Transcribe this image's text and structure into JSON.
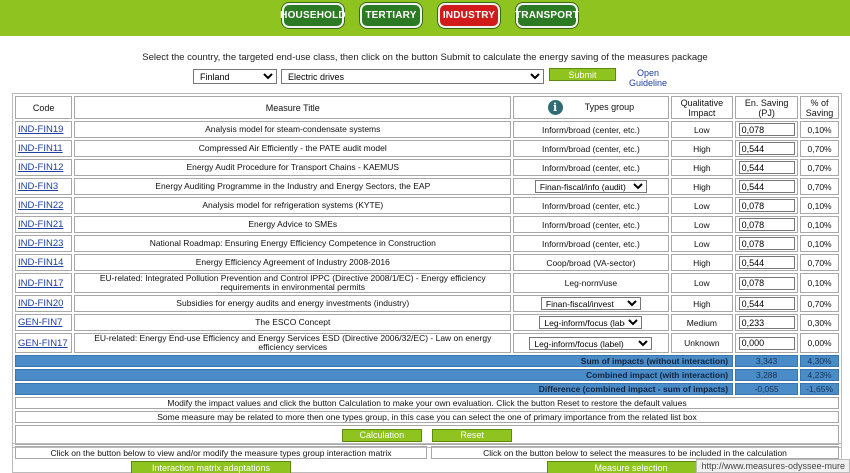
{
  "nav": {
    "household": "HOUSEHOLD",
    "tertiary": "TERTIARY",
    "industry": "INDUSTRY",
    "transport": "TRANSPORT"
  },
  "instructions": "Select the country, the targeted end-use class, then click on the button Submit to calculate the energy saving of the measures package",
  "filters": {
    "country": "Finland",
    "end_use": "Electric drives",
    "submit_label": "Submit",
    "guideline_label": "Open Guideline"
  },
  "table": {
    "headers": {
      "code": "Code",
      "title": "Measure Title",
      "types_group": "Types group",
      "impact": "Qualitative Impact",
      "saving": "En. Saving (PJ)",
      "pct": "% of Saving"
    },
    "rows": [
      {
        "code": "IND-FIN19",
        "title": "Analysis model for steam-condensate systems",
        "group": "Inform/broad (center, etc.)",
        "impact": "Low",
        "saving": "0,078",
        "pct": "0,10%"
      },
      {
        "code": "IND-FIN11",
        "title": "Compressed Air Efficiently - the PATE audit model",
        "group": "Inform/broad (center, etc.)",
        "impact": "High",
        "saving": "0,544",
        "pct": "0,70%"
      },
      {
        "code": "IND-FIN12",
        "title": "Energy Audit Procedure for Transport Chains - KAEMUS",
        "group": "Inform/broad (center, etc.)",
        "impact": "High",
        "saving": "0,544",
        "pct": "0,70%"
      },
      {
        "code": "IND-FIN3",
        "title": "Energy Auditing Programme in the Industry and Energy Sectors, the EAP",
        "group": "Finan-fiscal/info (audit)",
        "impact": "High",
        "saving": "0,544",
        "pct": "0,70%"
      },
      {
        "code": "IND-FIN22",
        "title": "Analysis model for refrigeration systems (KYTE)",
        "group": "Inform/broad (center, etc.)",
        "impact": "Low",
        "saving": "0,078",
        "pct": "0,10%"
      },
      {
        "code": "IND-FIN21",
        "title": "Energy Advice to SMEs",
        "group": "Inform/broad (center, etc.)",
        "impact": "Low",
        "saving": "0,078",
        "pct": "0,10%"
      },
      {
        "code": "IND-FIN23",
        "title": "National Roadmap: Ensuring Energy Efficiency Competence in Construction",
        "group": "Inform/broad (center, etc.)",
        "impact": "Low",
        "saving": "0,078",
        "pct": "0,10%"
      },
      {
        "code": "IND-FIN14",
        "title": "Energy Efficiency Agreement of Industry 2008-2016",
        "group": "Coop/broad (VA-sector)",
        "impact": "High",
        "saving": "0,544",
        "pct": "0,70%"
      },
      {
        "code": "IND-FIN17",
        "title": "EU-related: Integrated Pollution Prevention and Control IPPC (Directive 2008/1/EC) - Energy efficiency requirements in environmental permits",
        "group": "Leg-norm/use",
        "impact": "Low",
        "saving": "0,078",
        "pct": "0,10%"
      },
      {
        "code": "IND-FIN20",
        "title": "Subsidies for energy audits and energy investments (industry)",
        "group": "Finan-fiscal/invest",
        "impact": "High",
        "saving": "0,544",
        "pct": "0,70%"
      },
      {
        "code": "GEN-FIN7",
        "title": "The ESCO Concept",
        "group": "Leg-inform/focus (label)",
        "impact": "Medium",
        "saving": "0,233",
        "pct": "0,30%"
      },
      {
        "code": "GEN-FIN17",
        "title": "EU-related: Energy End-use Efficiency and Energy Services ESD (Directive 2006/32/EC) - Law on energy efficiency services",
        "group": "Leg-inform/focus (label)",
        "impact": "Unknown",
        "saving": "0,000",
        "pct": "0,00%"
      }
    ]
  },
  "summary": [
    {
      "label": "Sum of impacts (without interaction)",
      "saving": "3,343",
      "pct": "4,30%"
    },
    {
      "label": "Combined impact (with interaction)",
      "saving": "3,288",
      "pct": "4,23%"
    },
    {
      "label": "Difference (combined impact - sum of impacts)",
      "saving": "-0,055",
      "pct": "-1,65%"
    }
  ],
  "notes": {
    "note1": "Modify the impact values and click the button Calculation to make your own evaluation. Click the button Reset to restore the default values",
    "note2": "Some measure may be related to more then one types group, in this case you can select the one of primary importance from the related list box"
  },
  "buttons": {
    "calculation": "Calculation",
    "reset": "Reset",
    "interaction": "Interaction matrix adaptations",
    "measure_selection": "Measure selection"
  },
  "bottom": {
    "left_text": "Click on the button below to view and/or modify the measure types group interaction matrix",
    "right_text": "Click on the button below to select the measures to be included in the calculation"
  },
  "status_url": "http://www.measures-odyssee-mure"
}
